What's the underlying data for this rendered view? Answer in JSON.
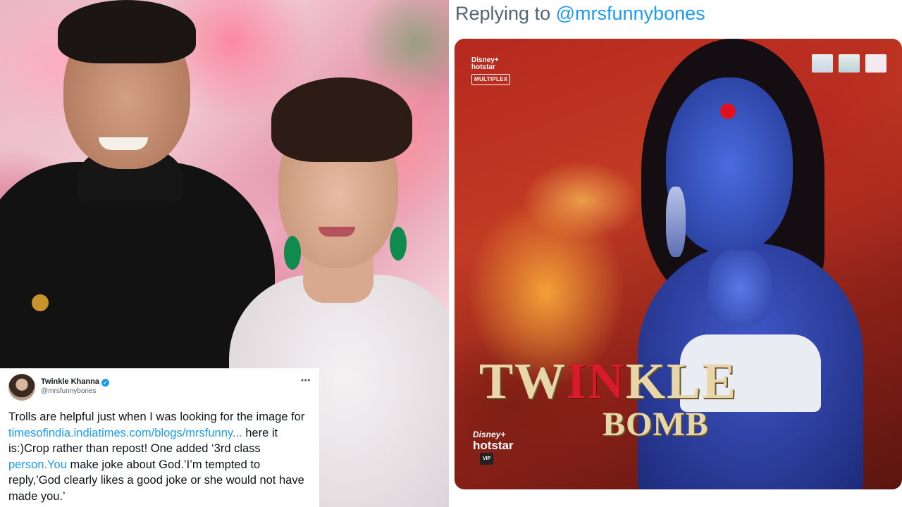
{
  "tweet": {
    "display_name": "Twinkle Khanna",
    "handle": "@mrsfunnybones",
    "more_icon": "ellipsis-icon",
    "verified_icon": "verified-badge-icon",
    "text_1": "Trolls are helpful just when I was looking for the image for ",
    "link": "timesofindia.indiatimes.com/blogs/mrsfunny...",
    "text_2": " here it is:)Crop rather than repost! One added ‘3rd class ",
    "person_link": "person.You",
    "text_3": " make joke about God.’I’m tempted to reply,’God clearly likes a good joke or she would not have made you.’"
  },
  "reply": {
    "prefix": "Replying to",
    "mention": "@mrsfunnybones"
  },
  "poster": {
    "brand_top_disney": "Disney+",
    "brand_top_hotstar": "hotstar",
    "multiplex": "MULTIPLEX",
    "title_part1": "TW",
    "title_part2": "IN",
    "title_part3": "KLE",
    "subtitle": "BOMB",
    "brand_bottom_disney": "Disney+",
    "brand_bottom_hotstar": "hotstar",
    "vip": "VIP"
  },
  "colors": {
    "link": "#1d9bf0",
    "secondary_text": "#536471",
    "poster_red": "#b6281e",
    "figure_blue": "#3f57c9"
  }
}
